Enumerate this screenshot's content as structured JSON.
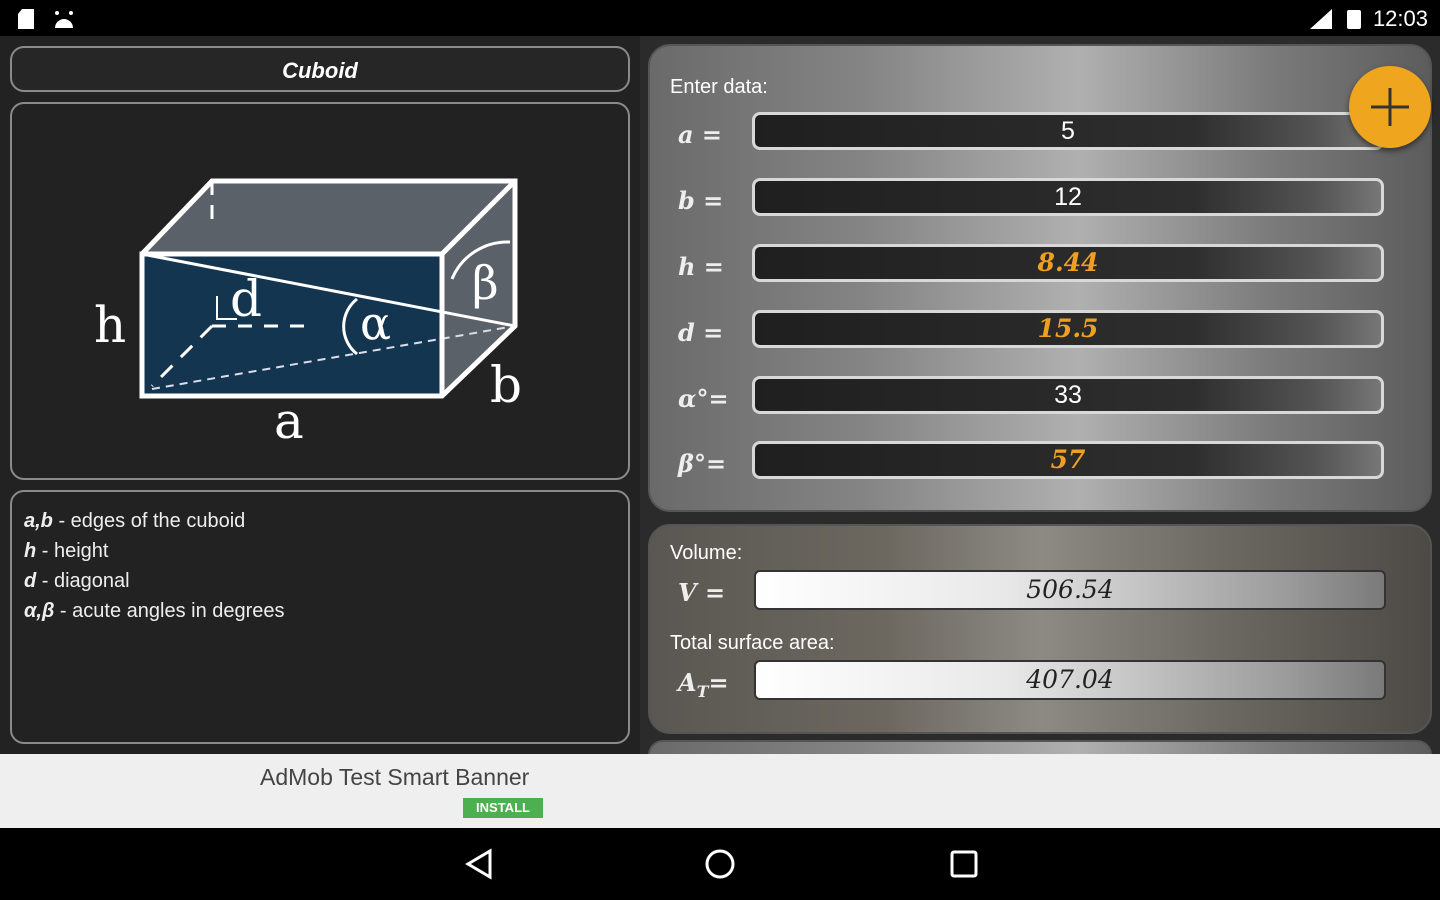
{
  "status_bar": {
    "time": "12:03"
  },
  "left": {
    "title": "Cuboid",
    "figure": {
      "labels": {
        "a": "a",
        "b": "b",
        "h": "h",
        "d": "d",
        "alpha": "α",
        "beta": "β"
      }
    },
    "legend": [
      {
        "key": "a,b",
        "text": " - edges of the cuboid"
      },
      {
        "key": "h",
        "text": " - height"
      },
      {
        "key": "d",
        "text": " - diagonal"
      },
      {
        "key": "α,β",
        "text": " - acute angles in degrees"
      }
    ]
  },
  "input": {
    "section_label": "Enter data:",
    "fields": [
      {
        "label": "a =",
        "value": "5"
      },
      {
        "label": "b =",
        "value": "12"
      },
      {
        "label": "h =",
        "value": "8.44"
      },
      {
        "label": "d =",
        "value": "15.5"
      },
      {
        "label": "α°=",
        "value": "33"
      },
      {
        "label": "β°=",
        "value": "57"
      }
    ]
  },
  "output": {
    "volume_label": "Volume:",
    "volume_var": "V =",
    "volume_value": "506.54",
    "area_label": "Total surface area:",
    "area_var": "A",
    "area_sub": "T",
    "area_eq": "=",
    "area_value": "407.04"
  },
  "ad": {
    "text": "AdMob Test Smart Banner",
    "install": "INSTALL"
  },
  "colors": {
    "accent": "#f0a51e",
    "calc_value": "#f0a020",
    "cuboid_face": "#14354f"
  }
}
